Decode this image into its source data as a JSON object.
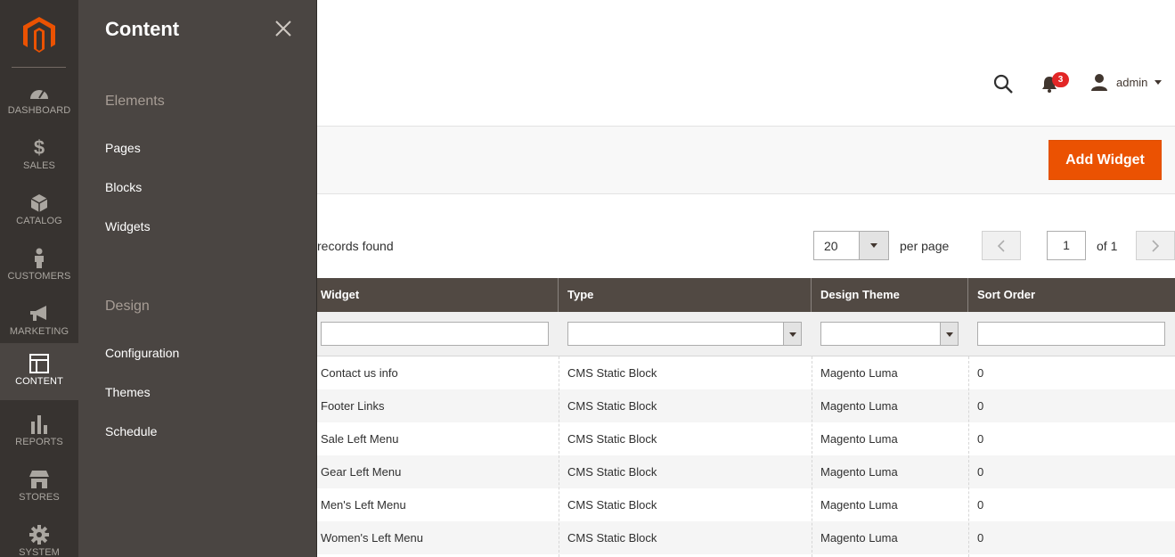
{
  "nav": {
    "items": [
      {
        "label": "DASHBOARD",
        "icon": "dashboard-icon"
      },
      {
        "label": "SALES",
        "icon": "dollar-icon"
      },
      {
        "label": "CATALOG",
        "icon": "box-icon"
      },
      {
        "label": "CUSTOMERS",
        "icon": "person-icon"
      },
      {
        "label": "MARKETING",
        "icon": "megaphone-icon"
      },
      {
        "label": "CONTENT",
        "icon": "layout-icon"
      },
      {
        "label": "REPORTS",
        "icon": "bar-chart-icon"
      },
      {
        "label": "STORES",
        "icon": "store-icon"
      },
      {
        "label": "SYSTEM",
        "icon": "gear-icon"
      }
    ],
    "active": "CONTENT"
  },
  "submenu": {
    "title": "Content",
    "sections": [
      {
        "heading": "Elements",
        "links": [
          "Pages",
          "Blocks",
          "Widgets"
        ]
      },
      {
        "heading": "Design",
        "links": [
          "Configuration",
          "Themes",
          "Schedule"
        ]
      }
    ]
  },
  "header": {
    "notifications_count": "3",
    "user": "admin"
  },
  "actions": {
    "add_button": "Add Widget"
  },
  "toolbar": {
    "records_text": "records found",
    "per_page_value": "20",
    "per_page_label": "per page",
    "page_value": "1",
    "page_of": "of 1"
  },
  "grid": {
    "columns": [
      "Widget",
      "Type",
      "Design Theme",
      "Sort Order"
    ],
    "rows": [
      [
        "Contact us info",
        "CMS Static Block",
        "Magento Luma",
        "0"
      ],
      [
        "Footer Links",
        "CMS Static Block",
        "Magento Luma",
        "0"
      ],
      [
        "Sale Left Menu",
        "CMS Static Block",
        "Magento Luma",
        "0"
      ],
      [
        "Gear Left Menu",
        "CMS Static Block",
        "Magento Luma",
        "0"
      ],
      [
        "Men's Left Menu",
        "CMS Static Block",
        "Magento Luma",
        "0"
      ],
      [
        "Women's Left Menu",
        "CMS Static Block",
        "Magento Luma",
        "0"
      ]
    ]
  },
  "colors": {
    "accent": "#eb5202",
    "nav_bg": "#373330",
    "submenu_bg": "#4a4542",
    "grid_header_bg": "#514943"
  }
}
